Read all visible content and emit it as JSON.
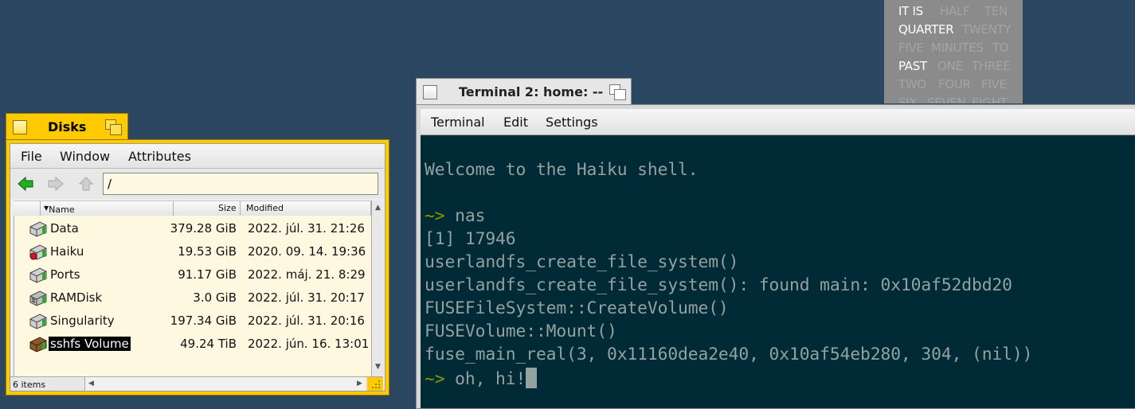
{
  "word_clock": {
    "rows": [
      [
        {
          "text": "IT IS",
          "lit": true
        },
        {
          "text": "HALF",
          "lit": false
        },
        {
          "text": "TEN",
          "lit": false
        }
      ],
      [
        {
          "text": "QUARTER",
          "lit": true
        },
        {
          "text": "TWENTY",
          "lit": false
        }
      ],
      [
        {
          "text": "FIVE",
          "lit": false
        },
        {
          "text": "MINUTES",
          "lit": false
        },
        {
          "text": "TO",
          "lit": false
        }
      ],
      [
        {
          "text": "PAST",
          "lit": true
        },
        {
          "text": "ONE",
          "lit": false
        },
        {
          "text": "THREE",
          "lit": false
        }
      ],
      [
        {
          "text": "TWO",
          "lit": false
        },
        {
          "text": "FOUR",
          "lit": false
        },
        {
          "text": "FIVE",
          "lit": false
        }
      ],
      [
        {
          "text": "SIX",
          "lit": false
        },
        {
          "text": "SEVEN",
          "lit": false
        },
        {
          "text": "EIGHT",
          "lit": false
        }
      ]
    ]
  },
  "disks": {
    "title": "Disks",
    "menu": [
      "File",
      "Window",
      "Attributes"
    ],
    "path": "/",
    "columns": {
      "name": "Name",
      "size": "Size",
      "modified": "Modified"
    },
    "rows": [
      {
        "name": "Data",
        "size": "379.28 GiB",
        "modified": "2022. júl. 31. 21:26",
        "icon": "disk-icon"
      },
      {
        "name": "Haiku",
        "size": "19.53 GiB",
        "modified": "2020. 09. 14. 19:36",
        "icon": "boot-disk-icon"
      },
      {
        "name": "Ports",
        "size": "91.17 GiB",
        "modified": "2022. máj. 21. 8:29",
        "icon": "disk-icon"
      },
      {
        "name": "RAMDisk",
        "size": "3.0 GiB",
        "modified": "2022. júl. 31. 20:17",
        "icon": "ramdisk-icon"
      },
      {
        "name": "Singularity",
        "size": "197.34 GiB",
        "modified": "2022. júl. 31. 20:16",
        "icon": "disk-icon"
      },
      {
        "name": "sshfs Volume",
        "size": "49.24 TiB",
        "modified": "2022. jún. 16. 13:01",
        "icon": "network-volume-icon",
        "selected": true
      }
    ],
    "status": "6 items"
  },
  "terminal": {
    "title": "Terminal 2: home: --",
    "menu": [
      "Terminal",
      "Edit",
      "Settings"
    ],
    "lines": [
      {
        "prompt": "",
        "text": "Welcome to the Haiku shell."
      },
      {
        "prompt": "",
        "text": ""
      },
      {
        "prompt": "~>",
        "text": " nas"
      },
      {
        "prompt": "",
        "text": "[1] 17946"
      },
      {
        "prompt": "",
        "text": "userlandfs_create_file_system()"
      },
      {
        "prompt": "",
        "text": "userlandfs_create_file_system(): found main: 0x10af52dbd20"
      },
      {
        "prompt": "",
        "text": "FUSEFileSystem::CreateVolume()"
      },
      {
        "prompt": "",
        "text": "FUSEVolume::Mount()"
      },
      {
        "prompt": "",
        "text": "fuse_main_real(3, 0x11160dea2e40, 0x10af54eb280, 304, (nil))"
      },
      {
        "prompt": "~>",
        "text": " oh, hi!",
        "cursor": true
      }
    ]
  },
  "colors": {
    "desktop": "#2a4660",
    "active_tab": "#ffcb00",
    "terminal_bg": "#002b36",
    "terminal_fg": "#93a1a1",
    "prompt": "#859900"
  }
}
